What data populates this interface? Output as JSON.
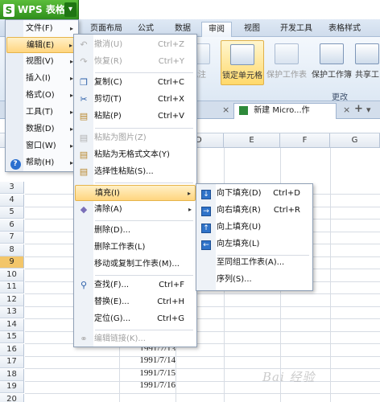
{
  "app": {
    "title": "WPS 表格",
    "logo_letter": "S",
    "arrow": "▾"
  },
  "ribbon_tabs": [
    "页面布局",
    "公式",
    "数据",
    "审阅",
    "视图",
    "开发工具",
    "表格样式"
  ],
  "ribbon_buttons": {
    "pizhu": "批注",
    "lock_cell": "锁定单元格",
    "protect_sheet": "保护工作表",
    "protect_book": "保护工作簿",
    "share_book": "共享工"
  },
  "ribbon_group": "更改",
  "doc_tab": {
    "title": "新建 Micro...作表.xls *",
    "close": "×",
    "add": "+",
    "dropdown": "▾"
  },
  "columns": [
    "D",
    "E",
    "F",
    "G"
  ],
  "rows": [
    "3",
    "4",
    "5",
    "6",
    "7",
    "8",
    "9",
    "10",
    "11",
    "12",
    "13",
    "14",
    "15",
    "16",
    "17",
    "18",
    "19",
    "20",
    "21"
  ],
  "selected_row": "9",
  "cells": [
    {
      "row": "18",
      "value": "1991/7/14"
    },
    {
      "row": "19",
      "value": "1991/7/15"
    },
    {
      "row": "20",
      "value": "1991/7/16"
    }
  ],
  "main_menu": [
    {
      "label": "文件(F)",
      "arrow": "▸"
    },
    {
      "label": "编辑(E)",
      "arrow": "▸",
      "hot": true
    },
    {
      "label": "视图(V)",
      "arrow": "▸"
    },
    {
      "label": "插入(I)",
      "arrow": "▸"
    },
    {
      "label": "格式(O)",
      "arrow": "▸"
    },
    {
      "label": "工具(T)",
      "arrow": "▸"
    },
    {
      "label": "数据(D)",
      "arrow": "▸"
    },
    {
      "label": "窗口(W)",
      "arrow": "▸"
    },
    {
      "label": "帮助(H)",
      "arrow": "▸"
    }
  ],
  "edit_menu": [
    {
      "label": "撤消(U)",
      "shortcut": "Ctrl+Z",
      "disabled": true
    },
    {
      "label": "恢复(R)",
      "shortcut": "Ctrl+Y",
      "disabled": true
    },
    {
      "label": "复制(C)",
      "shortcut": "Ctrl+C"
    },
    {
      "label": "剪切(T)",
      "shortcut": "Ctrl+X"
    },
    {
      "label": "粘贴(P)",
      "shortcut": "Ctrl+V"
    },
    {
      "label": "粘贴为图片(Z)",
      "disabled": true
    },
    {
      "label": "粘贴为无格式文本(Y)"
    },
    {
      "label": "选择性粘贴(S)..."
    },
    {
      "label": "填充(I)",
      "arrow": "▸",
      "hot": true
    },
    {
      "label": "清除(A)",
      "arrow": "▸"
    },
    {
      "label": "删除(D)..."
    },
    {
      "label": "删除工作表(L)"
    },
    {
      "label": "移动或复制工作表(M)..."
    },
    {
      "label": "查找(F)...",
      "shortcut": "Ctrl+F"
    },
    {
      "label": "替换(E)...",
      "shortcut": "Ctrl+H"
    },
    {
      "label": "定位(G)...",
      "shortcut": "Ctrl+G"
    },
    {
      "label": "编辑链接(K)...",
      "disabled": true
    }
  ],
  "fill_menu": [
    {
      "label": "向下填充(D)",
      "shortcut": "Ctrl+D"
    },
    {
      "label": "向右填充(R)",
      "shortcut": "Ctrl+R"
    },
    {
      "label": "向上填充(U)"
    },
    {
      "label": "向左填充(L)"
    },
    {
      "label": "至同组工作表(A)..."
    },
    {
      "label": "序列(S)..."
    }
  ],
  "watermark": "Bai 经验"
}
